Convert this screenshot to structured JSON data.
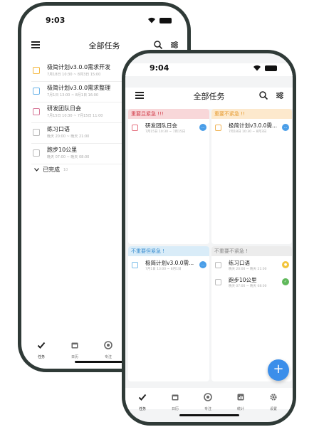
{
  "phone1": {
    "time": "9:03",
    "title": "全部任务",
    "tasks": [
      {
        "name": "极简计划v3.0.0需求开发",
        "sub": "7月18日 10:30 ~ 8月3日 15:00",
        "color": "#f5b942"
      },
      {
        "name": "极简计划v3.0.0需求整理",
        "sub": "7月1日 13:00 ~ 8月1日 16:00",
        "color": "#6db5e9"
      },
      {
        "name": "研发团队日会",
        "sub": "7月15日 10:30 ~ 7月15日 11:00",
        "color": "#d77a9a"
      },
      {
        "name": "练习口语",
        "sub": "晚天 20:00 ~ 晚天 21:00",
        "color": "#bbbbbb"
      },
      {
        "name": "跑步10公里",
        "sub": "晚天 07:00 ~ 晚天 08:00",
        "color": "#bbbbbb"
      }
    ],
    "completed_label": "已完成",
    "completed_count": "10",
    "tabs": [
      "任务",
      "日历",
      "专注"
    ]
  },
  "phone2": {
    "time": "9:04",
    "title": "全部任务",
    "quadrants": [
      {
        "header": "重要且紧急 !!!",
        "bg": "#f8d7d9",
        "fg": "#d3404d",
        "cb": "#e57381",
        "items": [
          {
            "name": "研发团队日会",
            "sub": "7月15日 10:30 ~ 7月15日",
            "dot_color": "#4a9ee8",
            "dot_text": "..."
          }
        ]
      },
      {
        "header": "重要不紧急 !!",
        "bg": "#fde9cd",
        "fg": "#e69a2e",
        "cb": "#f0b456",
        "items": [
          {
            "name": "极简计划v3.0.0需...",
            "sub": "7月18日 10:30 ~ 8月3日",
            "dot_color": "#4a9ee8",
            "dot_text": "..."
          }
        ]
      },
      {
        "header": "不重要但紧急 !",
        "bg": "#d9ecf8",
        "fg": "#3a8ed0",
        "cb": "#7fc0ea",
        "items": [
          {
            "name": "极简计划v3.0.0需...",
            "sub": "7月1日 13:00 ~ 8月1日",
            "dot_color": "#4a9ee8",
            "dot_text": "..."
          }
        ]
      },
      {
        "header": "不重要不紧急 !",
        "bg": "#ececec",
        "fg": "#888888",
        "cb": "#bbbbbb",
        "items": [
          {
            "name": "练习口语",
            "sub": "晚天 20:00 ~ 晚天 21:00",
            "dot_color": "#f2c43a",
            "dot_text": "●"
          },
          {
            "name": "跑步10公里",
            "sub": "晚天 07:00 ~ 晚天 08:00",
            "dot_color": "#5fb85a",
            "dot_text": "✓"
          }
        ]
      }
    ],
    "fab": "+",
    "tabs": [
      "任务",
      "日历",
      "专注",
      "统计",
      "设置"
    ]
  }
}
